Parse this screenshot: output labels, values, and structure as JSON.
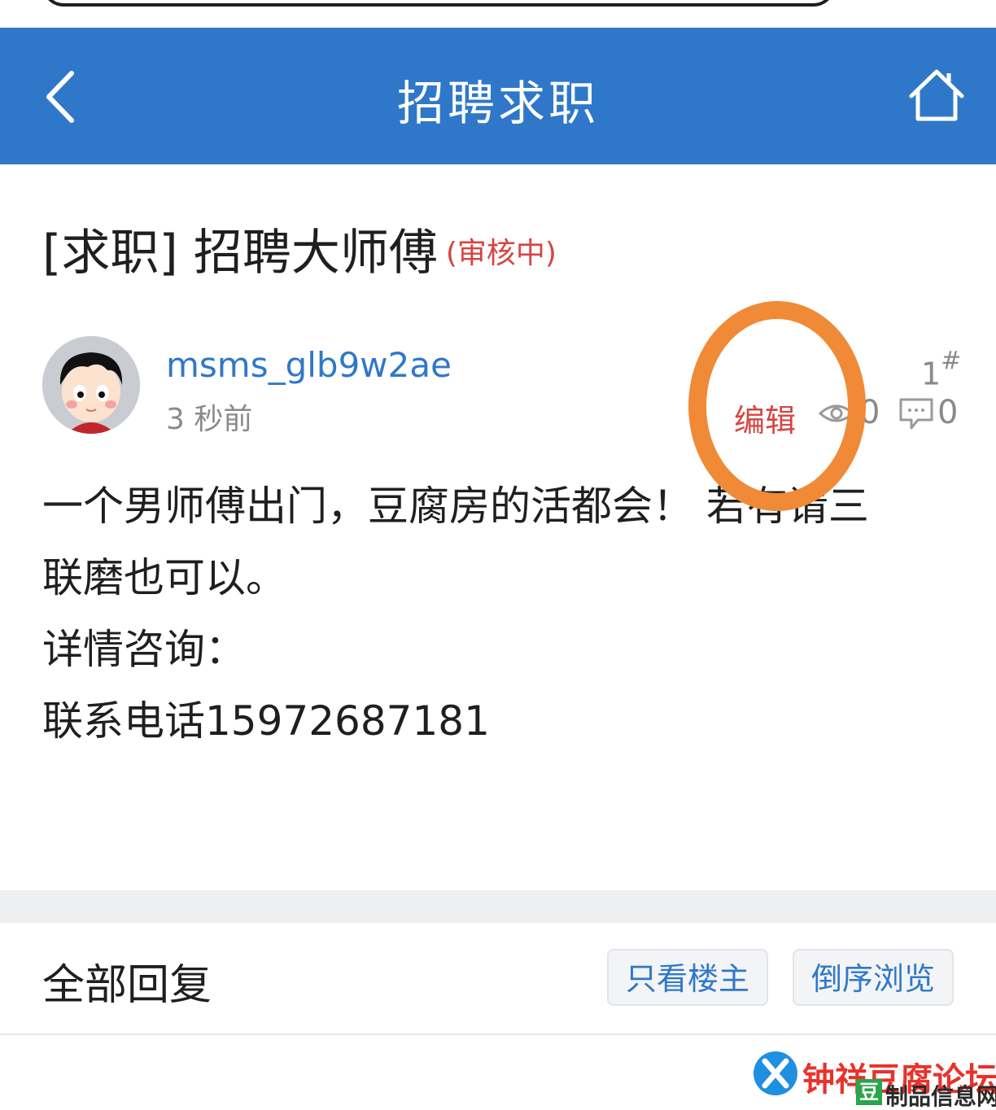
{
  "header": {
    "title": "招聘求职",
    "back_icon": "chevron-left-icon",
    "home_icon": "home-icon",
    "background": "#2f78c9"
  },
  "post": {
    "title": "[求职] 招聘大师傅",
    "status": "(审核中)",
    "author": "msms_glb9w2ae",
    "time": "3 秒前",
    "floor": "1",
    "floor_mark": "#",
    "edit_label": "编辑",
    "views": "0",
    "replies": "0",
    "body_lines": [
      "一个男师傅出门，豆腐房的活都会！ 若有请三",
      "联磨也可以。",
      "详情咨询：",
      "联系电话15972687181"
    ]
  },
  "replies_section": {
    "label": "全部回复",
    "only_owner": "只看楼主",
    "reverse": "倒序浏览"
  },
  "watermark": {
    "main": "钟祥豆腐论坛",
    "badge": "豆",
    "sub": "制品信息网"
  },
  "colors": {
    "accent": "#2f78c9",
    "status_red": "#d64541",
    "highlight_orange": "#f08a36"
  }
}
